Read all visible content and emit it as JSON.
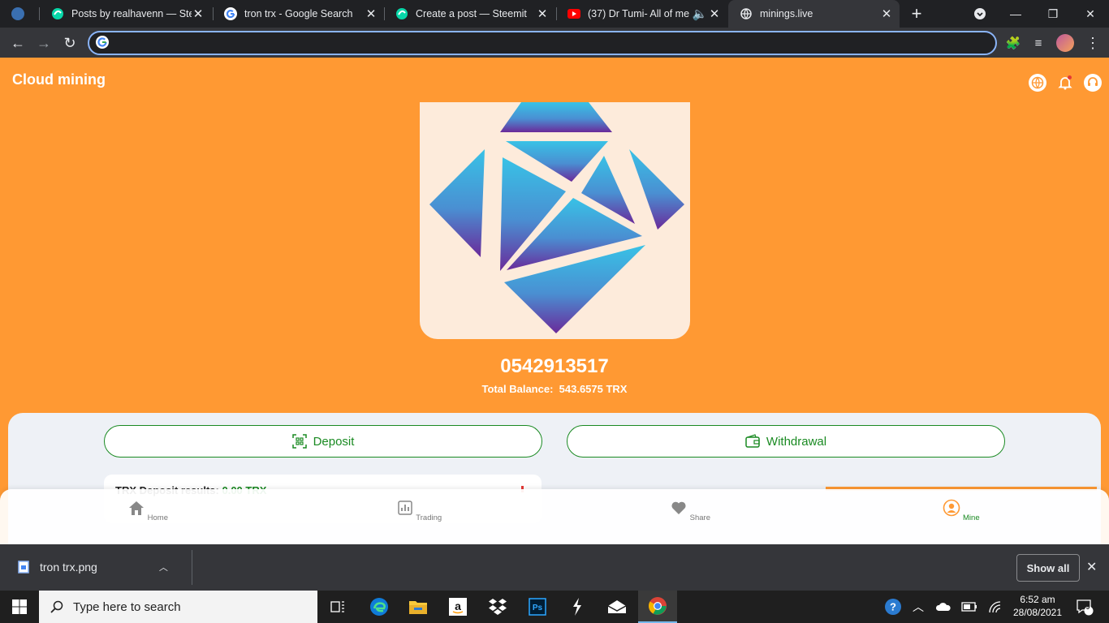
{
  "browser": {
    "tabs": [
      {
        "title": "",
        "icon": "chrome-app-icon",
        "active": false
      },
      {
        "title": "Posts by realhavenn — Steemit",
        "icon": "steemit-icon",
        "active": false
      },
      {
        "title": "tron trx - Google Search",
        "icon": "google-icon",
        "active": false
      },
      {
        "title": "Create a post — Steemit",
        "icon": "steemit-icon",
        "active": false
      },
      {
        "title": "(37) Dr Tumi- All of me",
        "icon": "youtube-icon",
        "active": false
      },
      {
        "title": "minings.live",
        "icon": "globe-icon",
        "active": true
      }
    ],
    "address_value": "",
    "address_placeholder": ""
  },
  "page": {
    "brand": "Cloud mining",
    "account_id": "0542913517",
    "balance_label": "Total Balance:",
    "balance_value": "543.6575 TRX",
    "deposit_label": "Deposit",
    "withdrawal_label": "Withdrawal",
    "notice_title": "TRX Deposit results",
    "notice_amount": "0.00 TRX",
    "colors": {
      "primary": "#ff9933",
      "accent": "#1a8a22",
      "panel": "#eef1f6"
    }
  },
  "bottom_nav": [
    {
      "label": "Home",
      "icon": "home-icon",
      "active": false
    },
    {
      "label": "Trading",
      "icon": "chart-icon",
      "active": false
    },
    {
      "label": "Share",
      "icon": "heart-icon",
      "active": false
    },
    {
      "label": "Mine",
      "icon": "user-icon",
      "active": true
    }
  ],
  "download_bar": {
    "file_name": "tron trx.png",
    "show_all": "Show all"
  },
  "taskbar": {
    "search_placeholder": "Type here to search",
    "time": "6:52 am",
    "date": "28/08/2021",
    "notifications": "9"
  }
}
